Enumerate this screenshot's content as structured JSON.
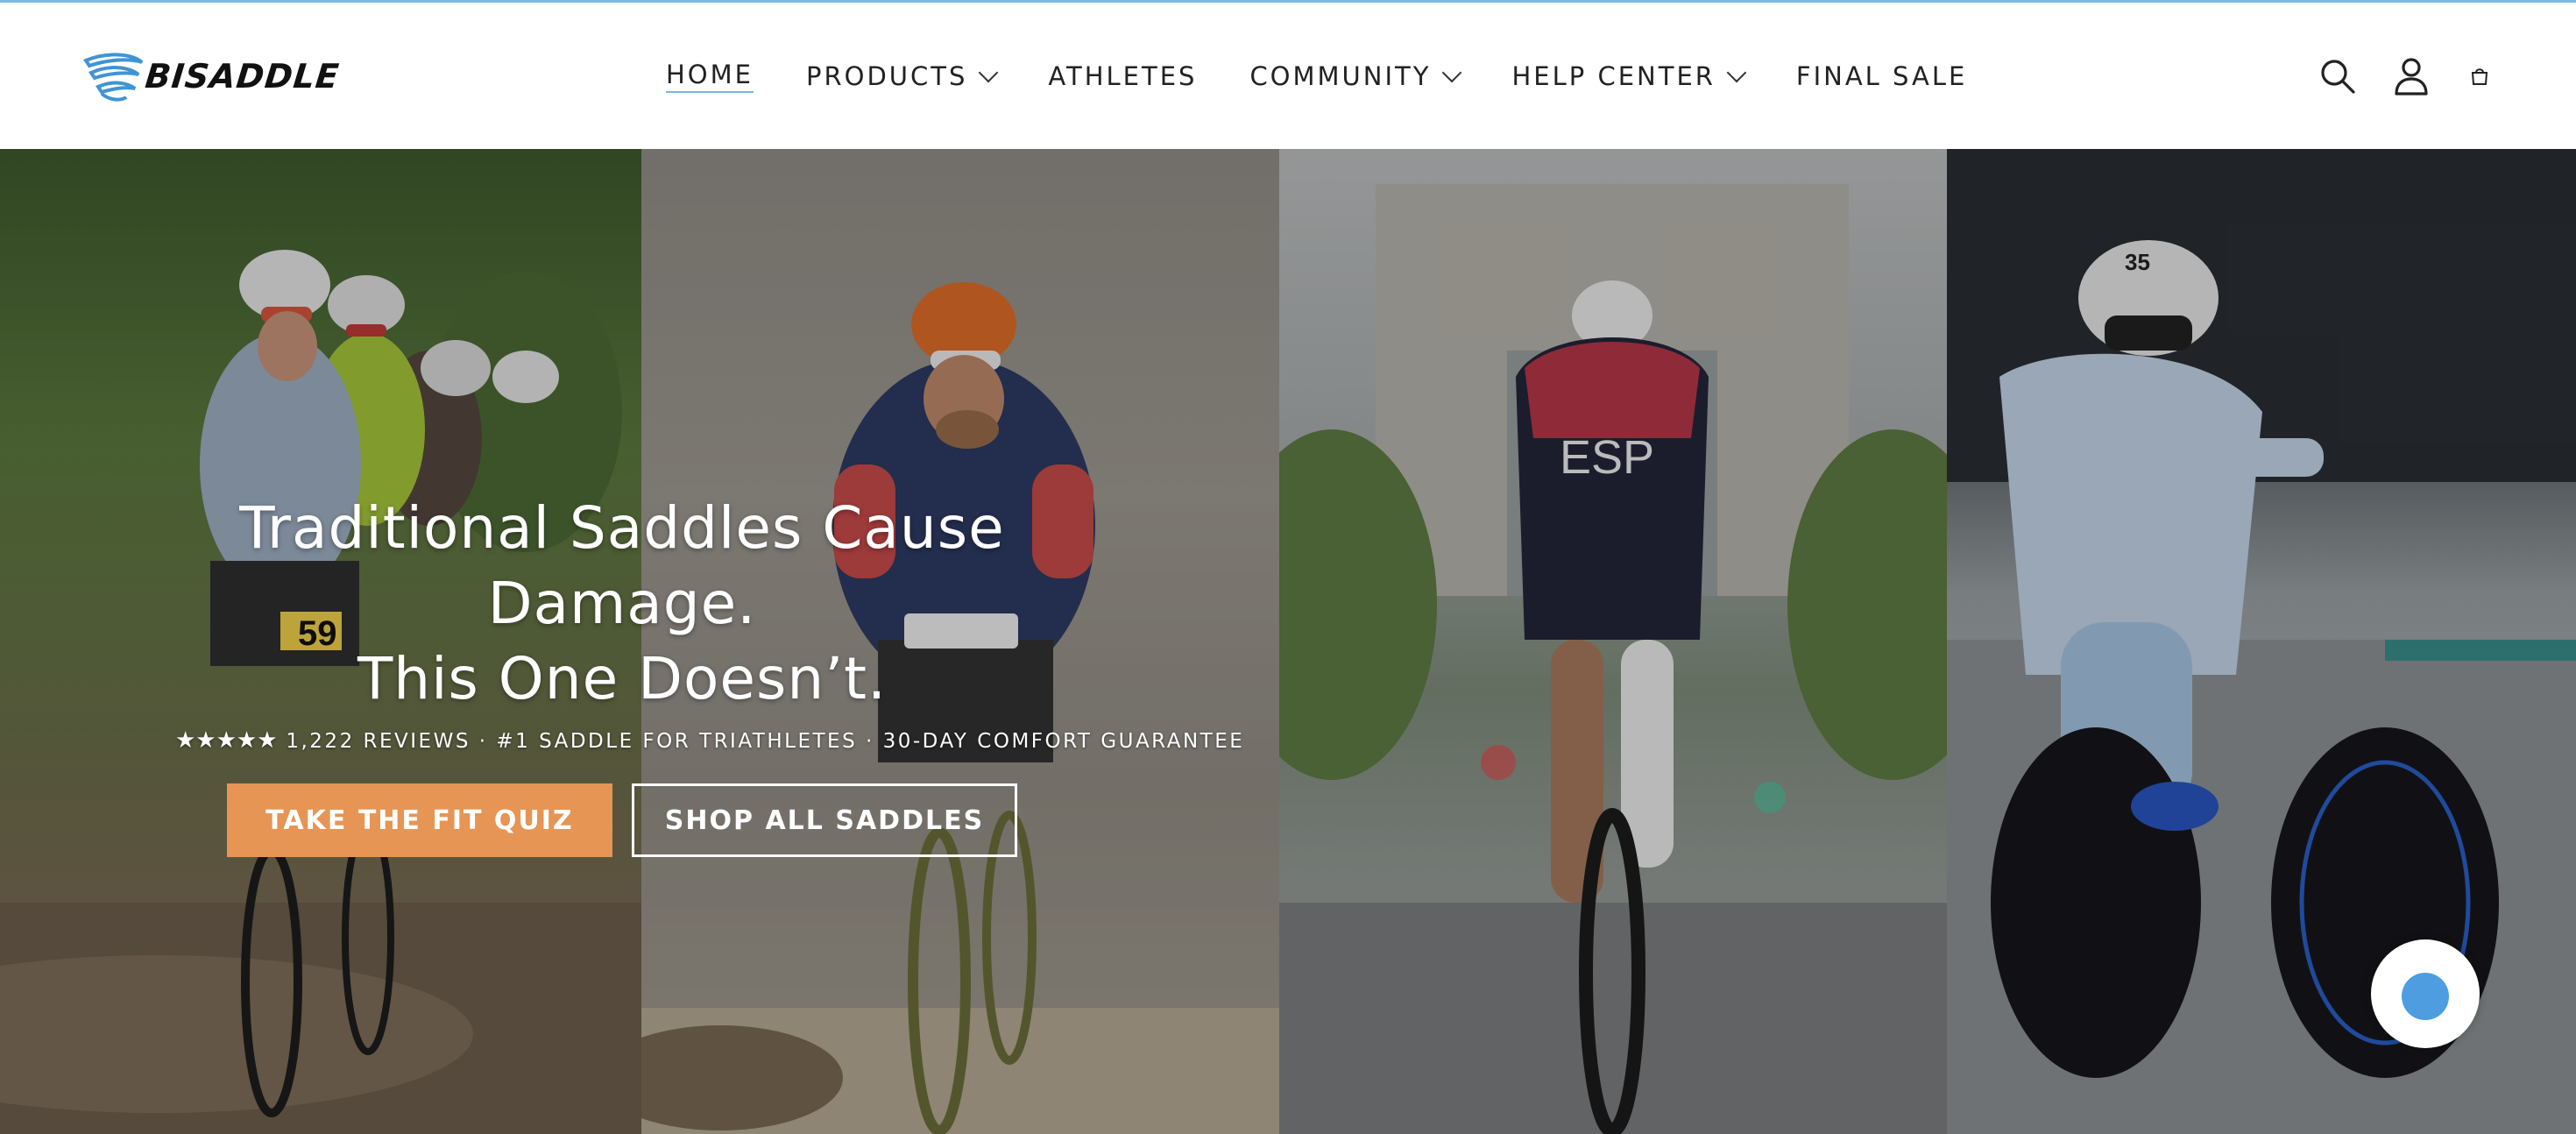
{
  "header": {
    "logo_text": "BISADDLE",
    "nav": [
      {
        "label": "HOME",
        "active": true,
        "dropdown": false
      },
      {
        "label": "PRODUCTS",
        "active": false,
        "dropdown": true
      },
      {
        "label": "ATHLETES",
        "active": false,
        "dropdown": false
      },
      {
        "label": "COMMUNITY",
        "active": false,
        "dropdown": true
      },
      {
        "label": "HELP CENTER",
        "active": false,
        "dropdown": true
      },
      {
        "label": "FINAL SALE",
        "active": false,
        "dropdown": false
      }
    ],
    "icons": [
      "search-icon",
      "account-icon",
      "cart-icon"
    ]
  },
  "hero": {
    "headline_line1": "Traditional Saddles Cause Damage.",
    "headline_line2": "This One Doesn’t.",
    "stars": "★★★★★",
    "tagline": "1,222 REVIEWS · #1 SADDLE FOR TRIATHLETES · 30-DAY COMFORT GUARANTEE",
    "primary_cta": "TAKE THE FIT QUIZ",
    "secondary_cta": "SHOP ALL SADDLES",
    "jersey_text": "ESP",
    "rider_number_1": "59",
    "helmet_number": "35"
  },
  "colors": {
    "accent": "#e69555",
    "brand_blue": "#4d9de0",
    "nav_underline": "#7fb6e0"
  }
}
